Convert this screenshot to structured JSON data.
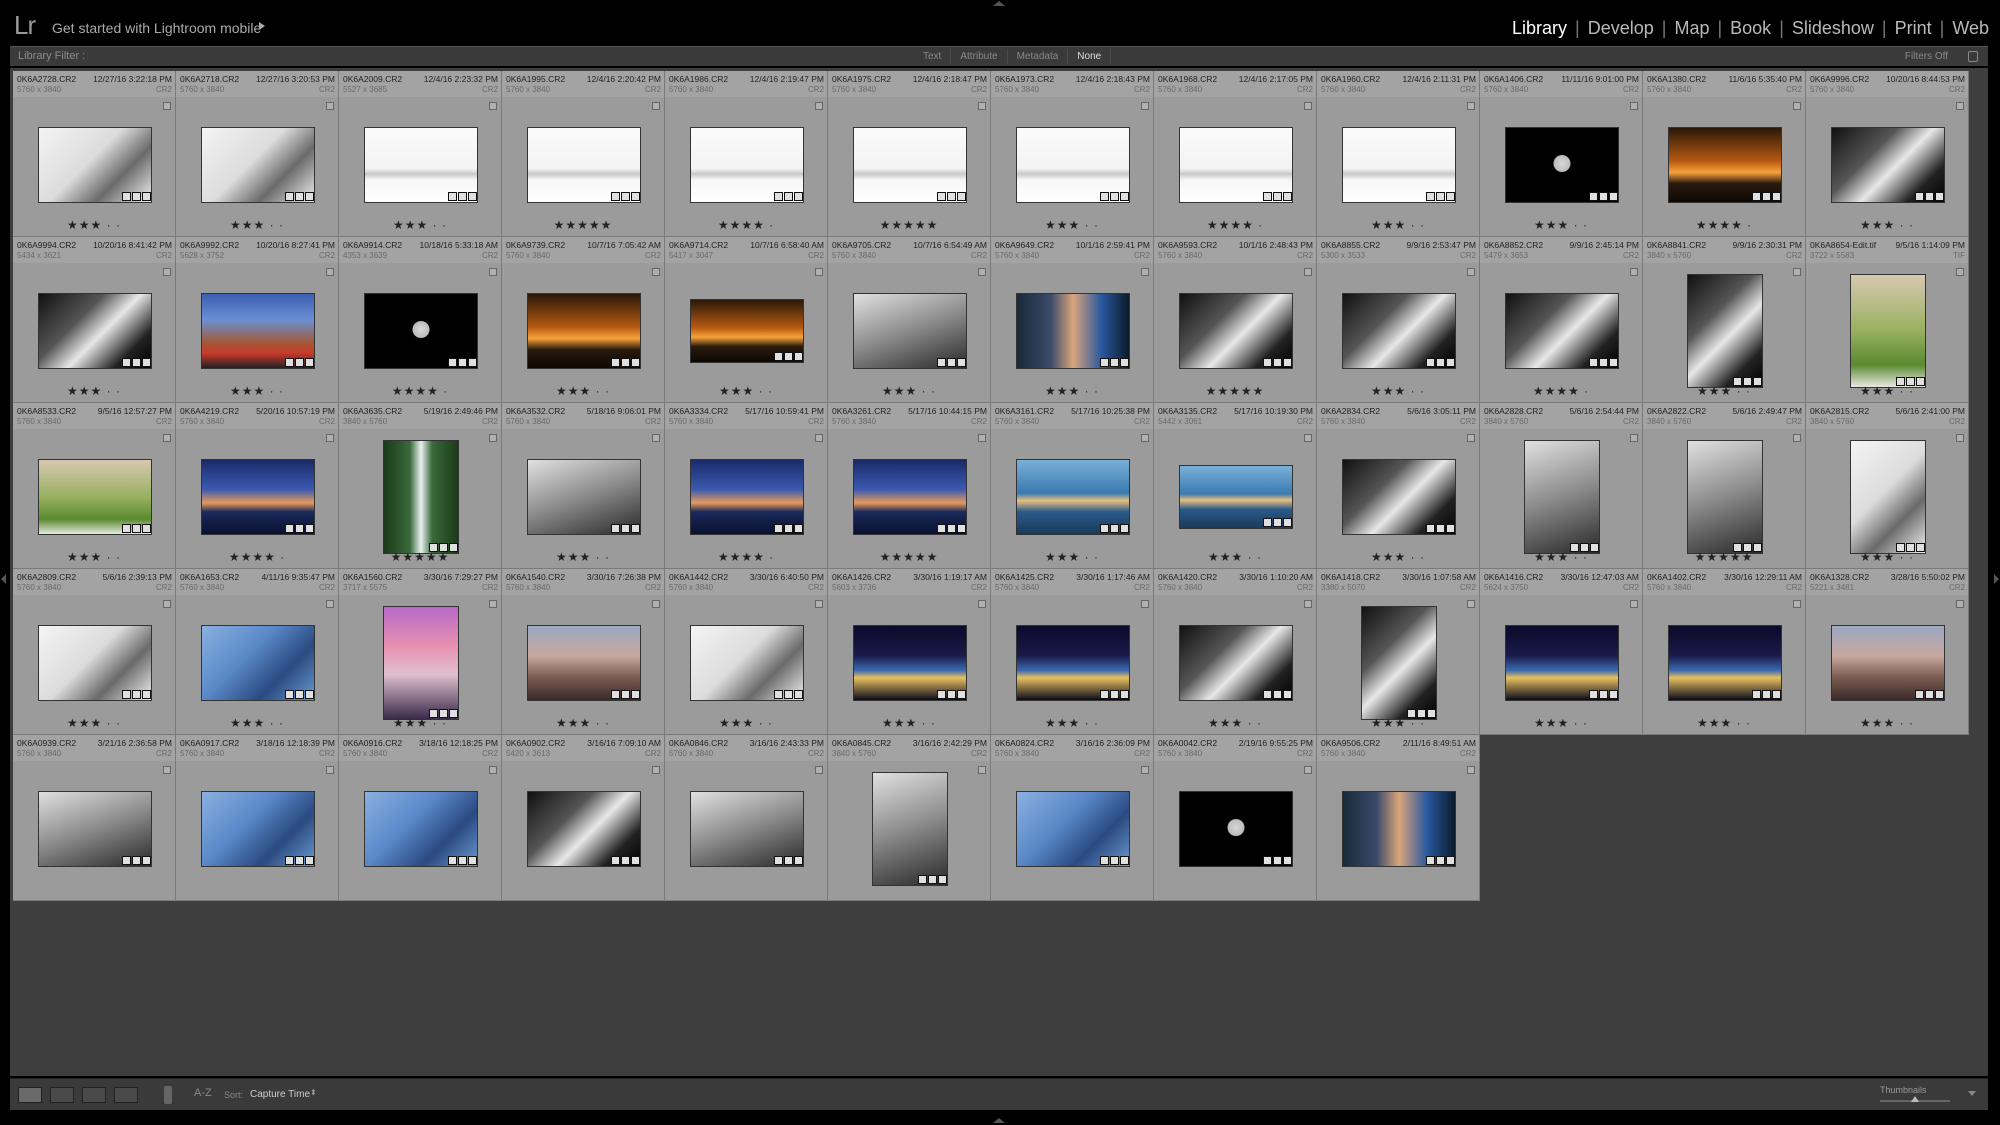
{
  "header": {
    "logo": "Lr",
    "mobile_promo": "Get started with Lightroom mobile",
    "modules": [
      {
        "label": "Library",
        "active": true
      },
      {
        "label": "Develop",
        "active": false
      },
      {
        "label": "Map",
        "active": false
      },
      {
        "label": "Book",
        "active": false
      },
      {
        "label": "Slideshow",
        "active": false
      },
      {
        "label": "Print",
        "active": false
      },
      {
        "label": "Web",
        "active": false
      }
    ]
  },
  "filter_bar": {
    "title": "Library Filter :",
    "tabs": [
      {
        "label": "Text",
        "active": false
      },
      {
        "label": "Attribute",
        "active": false
      },
      {
        "label": "Metadata",
        "active": false
      },
      {
        "label": "None",
        "active": true
      }
    ],
    "filters_status": "Filters Off"
  },
  "grid": {
    "cells": [
      {
        "name": "0K6A2728.CR2",
        "date": "12/27/16 3:22:18 PM",
        "dims": "5760 x 3840",
        "ext": "CR2",
        "stars": "★★★ · ·",
        "orient": "landscape",
        "tone": "bw-light"
      },
      {
        "name": "0K6A2718.CR2",
        "date": "12/27/16 3:20:53 PM",
        "dims": "5760 x 3840",
        "ext": "CR2",
        "stars": "★★★ · ·",
        "orient": "landscape",
        "tone": "bw-light"
      },
      {
        "name": "0K6A2009.CR2",
        "date": "12/4/16 2:23:32 PM",
        "dims": "5527 x 3685",
        "ext": "CR2",
        "stars": "★★★ · ·",
        "orient": "landscape",
        "tone": "snow"
      },
      {
        "name": "0K6A1995.CR2",
        "date": "12/4/16 2:20:42 PM",
        "dims": "5760 x 3840",
        "ext": "CR2",
        "stars": "★★★★★",
        "orient": "landscape",
        "tone": "snow"
      },
      {
        "name": "0K6A1986.CR2",
        "date": "12/4/16 2:19:47 PM",
        "dims": "5760 x 3840",
        "ext": "CR2",
        "stars": "★★★★ ·",
        "orient": "landscape",
        "tone": "snow"
      },
      {
        "name": "0K6A1975.CR2",
        "date": "12/4/16 2:18:47 PM",
        "dims": "5760 x 3840",
        "ext": "CR2",
        "stars": "★★★★★",
        "orient": "landscape",
        "tone": "snow"
      },
      {
        "name": "0K6A1973.CR2",
        "date": "12/4/16 2:18:43 PM",
        "dims": "5760 x 3840",
        "ext": "CR2",
        "stars": "★★★ · ·",
        "orient": "landscape",
        "tone": "snow"
      },
      {
        "name": "0K6A1968.CR2",
        "date": "12/4/16 2:17:05 PM",
        "dims": "5760 x 3840",
        "ext": "CR2",
        "stars": "★★★★ ·",
        "orient": "landscape",
        "tone": "snow"
      },
      {
        "name": "0K6A1960.CR2",
        "date": "12/4/16 2:11:31 PM",
        "dims": "5760 x 3840",
        "ext": "CR2",
        "stars": "★★★ · ·",
        "orient": "landscape",
        "tone": "snow"
      },
      {
        "name": "0K6A1406.CR2",
        "date": "11/11/16 9:01:00 PM",
        "dims": "5760 x 3840",
        "ext": "CR2",
        "stars": "★★★ · ·",
        "orient": "landscape",
        "tone": "moon"
      },
      {
        "name": "0K6A1380.CR2",
        "date": "11/6/16 5:35:40 PM",
        "dims": "5760 x 3840",
        "ext": "CR2",
        "stars": "★★★★ ·",
        "orient": "landscape",
        "tone": "sunset"
      },
      {
        "name": "0K6A9996.CR2",
        "date": "10/20/16 8:44:53 PM",
        "dims": "5760 x 3840",
        "ext": "CR2",
        "stars": "★★★ · ·",
        "orient": "landscape",
        "tone": "bw-dark"
      },
      {
        "name": "0K6A9994.CR2",
        "date": "10/20/16 8:41:42 PM",
        "dims": "5434 x 3621",
        "ext": "CR2",
        "stars": "★★★ · ·",
        "orient": "landscape",
        "tone": "bw-dark"
      },
      {
        "name": "0K6A9992.CR2",
        "date": "10/20/16 8:27:41 PM",
        "dims": "5628 x 3752",
        "ext": "CR2",
        "stars": "★★★ · ·",
        "orient": "landscape",
        "tone": "city-blue"
      },
      {
        "name": "0K6A9914.CR2",
        "date": "10/18/16 5:33:18 AM",
        "dims": "4353 x 3639",
        "ext": "CR2",
        "stars": "★★★★ ·",
        "orient": "landscape",
        "tone": "moon"
      },
      {
        "name": "0K6A9739.CR2",
        "date": "10/7/16 7:05:42 AM",
        "dims": "5760 x 3840",
        "ext": "CR2",
        "stars": "★★★ · ·",
        "orient": "landscape",
        "tone": "sunset"
      },
      {
        "name": "0K6A9714.CR2",
        "date": "10/7/16 6:58:40 AM",
        "dims": "5417 x 3047",
        "ext": "CR2",
        "stars": "★★★ · ·",
        "orient": "wide",
        "tone": "sunset"
      },
      {
        "name": "0K6A9705.CR2",
        "date": "10/7/16 6:54:49 AM",
        "dims": "5760 x 3840",
        "ext": "CR2",
        "stars": "★★★ · ·",
        "orient": "landscape",
        "tone": "bw-mid"
      },
      {
        "name": "0K6A9649.CR2",
        "date": "10/1/16 2:59:41 PM",
        "dims": "5760 x 3840",
        "ext": "CR2",
        "stars": "★★★ · ·",
        "orient": "landscape",
        "tone": "portrait"
      },
      {
        "name": "0K6A9593.CR2",
        "date": "10/1/16 2:48:43 PM",
        "dims": "5760 x 3840",
        "ext": "CR2",
        "stars": "★★★★★",
        "orient": "landscape",
        "tone": "bw-dark"
      },
      {
        "name": "0K6A8855.CR2",
        "date": "9/9/16 2:53:47 PM",
        "dims": "5300 x 3533",
        "ext": "CR2",
        "stars": "★★★ · ·",
        "orient": "landscape",
        "tone": "bw-dark"
      },
      {
        "name": "0K6A8852.CR2",
        "date": "9/9/16 2:45:14 PM",
        "dims": "5479 x 3653",
        "ext": "CR2",
        "stars": "★★★★ ·",
        "orient": "landscape",
        "tone": "bw-dark"
      },
      {
        "name": "0K6A8841.CR2",
        "date": "9/9/16 2:30:31 PM",
        "dims": "3840 x 5760",
        "ext": "CR2",
        "stars": "★★★ · ·",
        "orient": "portrait",
        "tone": "bw-dark"
      },
      {
        "name": "0K6A8654-Edit.tif",
        "date": "9/5/16 1:14:09 PM",
        "dims": "3722 x 5583",
        "ext": "TIF",
        "stars": "★★★ · ·",
        "orient": "portrait",
        "tone": "green"
      },
      {
        "name": "0K6A8533.CR2",
        "date": "9/5/16 12:57:27 PM",
        "dims": "5760 x 3840",
        "ext": "CR2",
        "stars": "★★★ · ·",
        "orient": "landscape",
        "tone": "green"
      },
      {
        "name": "0K6A4219.CR2",
        "date": "5/20/16 10:57:19 PM",
        "dims": "5760 x 3840",
        "ext": "CR2",
        "stars": "★★★★ ·",
        "orient": "landscape",
        "tone": "blue-dusk"
      },
      {
        "name": "0K6A3635.CR2",
        "date": "5/19/16 2:49:46 PM",
        "dims": "3840 x 5760",
        "ext": "CR2",
        "stars": "★★★★★",
        "orient": "portrait",
        "tone": "forest"
      },
      {
        "name": "0K6A3532.CR2",
        "date": "5/18/16 9:06:01 PM",
        "dims": "5760 x 3840",
        "ext": "CR2",
        "stars": "★★★ · ·",
        "orient": "landscape",
        "tone": "bw-mid"
      },
      {
        "name": "0K6A3334.CR2",
        "date": "5/17/16 10:59:41 PM",
        "dims": "5760 x 3840",
        "ext": "CR2",
        "stars": "★★★★ ·",
        "orient": "landscape",
        "tone": "blue-dusk"
      },
      {
        "name": "0K6A3261.CR2",
        "date": "5/17/16 10:44:15 PM",
        "dims": "5760 x 3840",
        "ext": "CR2",
        "stars": "★★★★★",
        "orient": "landscape",
        "tone": "blue-dusk"
      },
      {
        "name": "0K6A3161.CR2",
        "date": "5/17/16 10:25:38 PM",
        "dims": "5760 x 3840",
        "ext": "CR2",
        "stars": "★★★ · ·",
        "orient": "landscape",
        "tone": "ocean"
      },
      {
        "name": "0K6A3135.CR2",
        "date": "5/17/16 10:19:30 PM",
        "dims": "5442 x 3061",
        "ext": "CR2",
        "stars": "★★★ · ·",
        "orient": "wide",
        "tone": "ocean"
      },
      {
        "name": "0K6A2834.CR2",
        "date": "5/6/16 3:05:11 PM",
        "dims": "5760 x 3840",
        "ext": "CR2",
        "stars": "★★★ · ·",
        "orient": "landscape",
        "tone": "bw-dark"
      },
      {
        "name": "0K6A2828.CR2",
        "date": "5/6/16 2:54:44 PM",
        "dims": "3840 x 5760",
        "ext": "CR2",
        "stars": "★★★ · ·",
        "orient": "portrait",
        "tone": "bw-mid"
      },
      {
        "name": "0K6A2822.CR2",
        "date": "5/6/16 2:49:47 PM",
        "dims": "3840 x 5760",
        "ext": "CR2",
        "stars": "★★★★★",
        "orient": "portrait",
        "tone": "bw-mid"
      },
      {
        "name": "0K6A2815.CR2",
        "date": "5/6/16 2:41:00 PM",
        "dims": "3840 x 5760",
        "ext": "CR2",
        "stars": "★★★ · ·",
        "orient": "portrait",
        "tone": "bw-light"
      },
      {
        "name": "0K6A2809.CR2",
        "date": "5/6/16 2:39:13 PM",
        "dims": "5760 x 3840",
        "ext": "CR2",
        "stars": "★★★ · ·",
        "orient": "landscape",
        "tone": "bw-light"
      },
      {
        "name": "0K6A1653.CR2",
        "date": "4/11/16 9:35:47 PM",
        "dims": "5760 x 3840",
        "ext": "CR2",
        "stars": "★★★ · ·",
        "orient": "landscape",
        "tone": "sky"
      },
      {
        "name": "0K6A1560.CR2",
        "date": "3/30/16 7:29:27 PM",
        "dims": "3717 x 5575",
        "ext": "CR2",
        "stars": "★★★ · ·",
        "orient": "portrait",
        "tone": "pink"
      },
      {
        "name": "0K6A1540.CR2",
        "date": "3/30/16 7:26:38 PM",
        "dims": "5760 x 3840",
        "ext": "CR2",
        "stars": "★★★ · ·",
        "orient": "landscape",
        "tone": "dusk-warm"
      },
      {
        "name": "0K6A1442.CR2",
        "date": "3/30/16 6:40:50 PM",
        "dims": "5760 x 3840",
        "ext": "CR2",
        "stars": "★★★ · ·",
        "orient": "landscape",
        "tone": "bw-light"
      },
      {
        "name": "0K6A1426.CR2",
        "date": "3/30/16 1:19:17 AM",
        "dims": "5603 x 3736",
        "ext": "CR2",
        "stars": "★★★ · ·",
        "orient": "landscape",
        "tone": "night"
      },
      {
        "name": "0K6A1425.CR2",
        "date": "3/30/16 1:17:46 AM",
        "dims": "5760 x 3840",
        "ext": "CR2",
        "stars": "★★★ · ·",
        "orient": "landscape",
        "tone": "night"
      },
      {
        "name": "0K6A1420.CR2",
        "date": "3/30/16 1:10:20 AM",
        "dims": "5760 x 3840",
        "ext": "CR2",
        "stars": "★★★ · ·",
        "orient": "landscape",
        "tone": "bw-dark"
      },
      {
        "name": "0K6A1418.CR2",
        "date": "3/30/16 1:07:58 AM",
        "dims": "3380 x 5070",
        "ext": "CR2",
        "stars": "★★★ · ·",
        "orient": "portrait",
        "tone": "bw-dark"
      },
      {
        "name": "0K6A1416.CR2",
        "date": "3/30/16 12:47:03 AM",
        "dims": "5624 x 3750",
        "ext": "CR2",
        "stars": "★★★ · ·",
        "orient": "landscape",
        "tone": "night"
      },
      {
        "name": "0K6A1402.CR2",
        "date": "3/30/16 12:29:11 AM",
        "dims": "5760 x 3840",
        "ext": "CR2",
        "stars": "★★★ · ·",
        "orient": "landscape",
        "tone": "night"
      },
      {
        "name": "0K6A1328.CR2",
        "date": "3/28/16 5:50:02 PM",
        "dims": "5221 x 3481",
        "ext": "CR2",
        "stars": "★★★ · ·",
        "orient": "landscape",
        "tone": "dusk-warm"
      },
      {
        "name": "0K6A0939.CR2",
        "date": "3/21/16 2:36:58 PM",
        "dims": "5760 x 3840",
        "ext": "CR2",
        "stars": "",
        "orient": "landscape",
        "tone": "bw-mid"
      },
      {
        "name": "0K6A0917.CR2",
        "date": "3/18/16 12:18:39 PM",
        "dims": "5760 x 3840",
        "ext": "CR2",
        "stars": "",
        "orient": "landscape",
        "tone": "sky"
      },
      {
        "name": "0K6A0916.CR2",
        "date": "3/18/16 12:18:25 PM",
        "dims": "5760 x 3840",
        "ext": "CR2",
        "stars": "",
        "orient": "landscape",
        "tone": "sky"
      },
      {
        "name": "0K6A0902.CR2",
        "date": "3/16/16 7:09:10 AM",
        "dims": "5420 x 3613",
        "ext": "CR2",
        "stars": "",
        "orient": "landscape",
        "tone": "bw-dark"
      },
      {
        "name": "0K6A0846.CR2",
        "date": "3/16/16 2:43:33 PM",
        "dims": "5760 x 3840",
        "ext": "CR2",
        "stars": "",
        "orient": "landscape",
        "tone": "bw-mid"
      },
      {
        "name": "0K6A0845.CR2",
        "date": "3/16/16 2:42:29 PM",
        "dims": "3840 x 5760",
        "ext": "CR2",
        "stars": "",
        "orient": "portrait",
        "tone": "bw-mid"
      },
      {
        "name": "0K6A0824.CR2",
        "date": "3/16/16 2:36:09 PM",
        "dims": "5760 x 3840",
        "ext": "CR2",
        "stars": "",
        "orient": "landscape",
        "tone": "sky"
      },
      {
        "name": "0K6A0042.CR2",
        "date": "2/19/16 9:55:25 PM",
        "dims": "5760 x 3840",
        "ext": "CR2",
        "stars": "",
        "orient": "landscape",
        "tone": "moon"
      },
      {
        "name": "0K6A9506.CR2",
        "date": "2/11/16 8:49:51 AM",
        "dims": "5760 x 3840",
        "ext": "CR2",
        "stars": "",
        "orient": "landscape",
        "tone": "portrait"
      }
    ]
  },
  "toolbar": {
    "sort_label": "Sort:",
    "sort_value": "Capture Time",
    "sort_az": "A-Z",
    "thumbnails_label": "Thumbnails",
    "thumbnail_size": 0.5
  },
  "tones": {
    "bw-light": "linear-gradient(135deg,#f4f4f4 0%,#dcdcdc 45%,#6a6a6a 70%,#f0f0f0 100%)",
    "bw-mid": "linear-gradient(160deg,#e0e0e0 0%,#8a8a8a 50%,#2a2a2a 100%)",
    "bw-dark": "linear-gradient(135deg,#111 0%,#555 35%,#e8e8e8 55%,#222 80%,#000 100%)",
    "snow": "linear-gradient(180deg,#fbfbfb 0%,#f3f3f3 55%,#c9c9c9 62%,#f6f6f6 70%,#ffffff 100%)",
    "moon": "radial-gradient(circle at 50% 48%,#d8d8d8 0,#bcbcbc 12%,#000 13%,#000 100%)",
    "sunset": "linear-gradient(180deg,#2a1808 0%,#b75a12 45%,#f7a23a 60%,#2a1a0e 75%,#0d0804 100%)",
    "city-blue": "linear-gradient(180deg,#3c5fb0 0%,#6b8fd4 35%,#a05a3a 65%,#c93a2a 80%,#222 100%)",
    "portrait": "linear-gradient(90deg,#1a2a3a 0%,#3a4a6a 30%,#d9a47a 50%,#2a5aa0 75%,#0a1a2a 100%)",
    "green": "linear-gradient(180deg,#d8c8b0 0%,#98b060 50%,#5a8a30 80%,#e8e8e0 100%)",
    "blue-dusk": "linear-gradient(180deg,#1a2a6a 0%,#3a5ab0 40%,#e89a5a 58%,#1a2a5a 70%,#0a1030 100%)",
    "forest": "linear-gradient(90deg,#1a3a1a 0%,#3a6a3a 35%,#e8f0f0 50%,#3a6a3a 65%,#1a3a1a 100%)",
    "ocean": "linear-gradient(180deg,#7ab0d8 0%,#3a7ab0 45%,#e8c080 55%,#2a5a8a 70%,#1a3a5a 100%)",
    "sky": "linear-gradient(135deg,#8ab0e0 0%,#5a88c8 40%,#2a4a80 70%,#6a9ad0 100%)",
    "pink": "linear-gradient(180deg,#b86ac8 0%,#e890b0 35%,#e0c0d0 60%,#3a2a4a 100%)",
    "dusk-warm": "linear-gradient(180deg,#9aa8c0 0%,#c8a8a0 40%,#7a5a50 70%,#3a2a2a 100%)",
    "night": "linear-gradient(180deg,#0a0a2a 0%,#1a1a4a 40%,#3a6ab0 60%,#e8c060 70%,#0a0a1a 100%)"
  }
}
